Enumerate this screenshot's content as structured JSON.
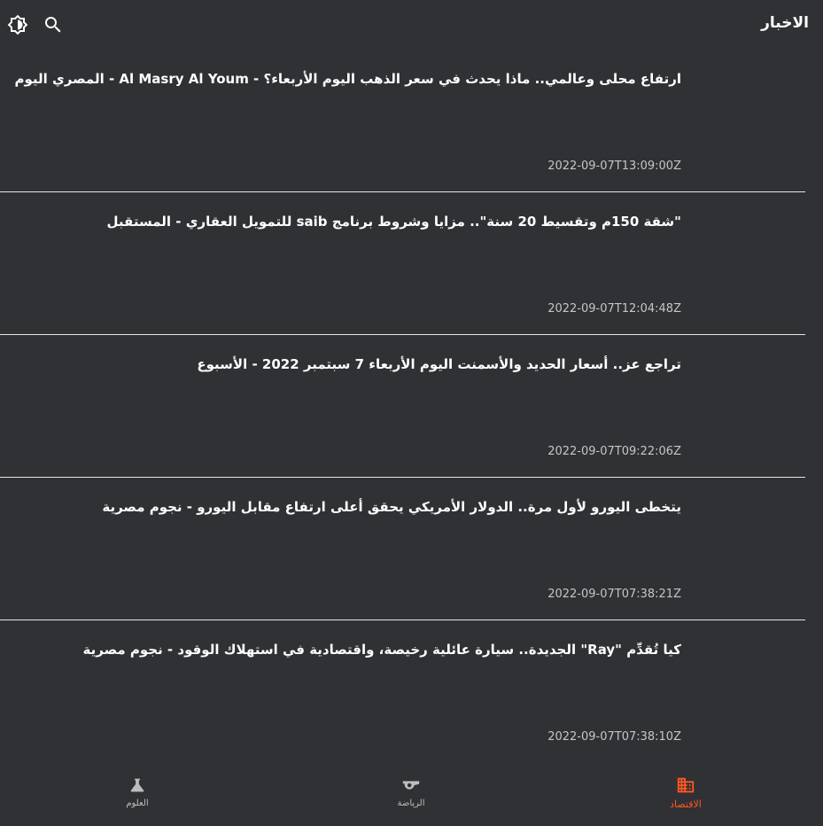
{
  "header": {
    "title": "الاخبار",
    "search_icon": "search-icon",
    "theme_icon": "brightness-icon"
  },
  "news": [
    {
      "headline": "ارتفاع محلى وعالمي.. ماذا يحدث في سعر الذهب اليوم الأربعاء؟ - Al Masry Al Youm - المصري اليوم",
      "date": "2022-09-07T13:09:00Z"
    },
    {
      "headline": "\"شقة 150م وتقسيط 20 سنة\".. مزايا وشروط برنامج saib للتمويل العقاري - المستقبل",
      "date": "2022-09-07T12:04:48Z"
    },
    {
      "headline": "تراجع عز.. أسعار الحديد والأسمنت اليوم الأربعاء 7 سبتمبر 2022 - الأسبوع",
      "date": "2022-09-07T09:22:06Z"
    },
    {
      "headline": "يتخطى اليورو لأول مرة.. الدولار الأمريكي يحقق أعلى ارتفاع مقابل اليورو - نجوم مصرية",
      "date": "2022-09-07T07:38:21Z"
    },
    {
      "headline": "كيا تُقدِّم \"Ray\" الجديدة.. سيارة عائلية رخيصة، واقتصادية في استهلاك الوقود - نجوم مصرية",
      "date": "2022-09-07T07:38:10Z"
    }
  ],
  "bottom_nav": {
    "science": {
      "label": "العلوم",
      "icon": "flask-icon"
    },
    "sports": {
      "label": "الرياضة",
      "icon": "whistle-icon"
    },
    "economy": {
      "label": "الاقتصاد",
      "icon": "business-icon",
      "active": true
    }
  },
  "colors": {
    "background": "#303134",
    "accent": "#ff5722",
    "divider": "#e6e6e6",
    "date_text": "#c6c6c6"
  }
}
